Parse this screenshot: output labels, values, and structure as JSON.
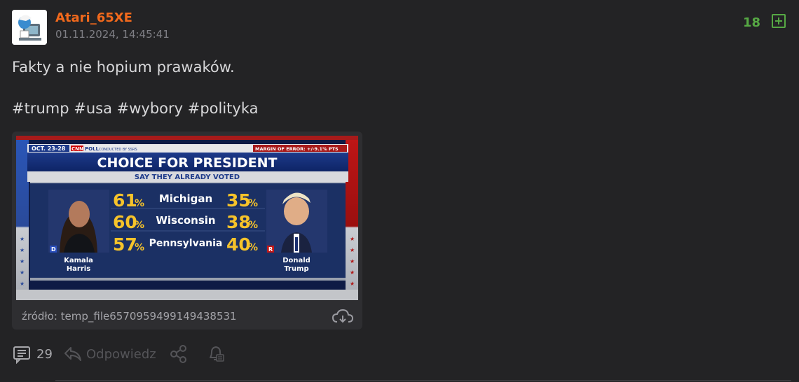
{
  "post": {
    "author": "Atari_65XE",
    "date": "01.11.2024, 14:45:41",
    "score": "18",
    "lines": [
      "Fakty a nie hopium prawaków.",
      "#trump #usa #wybory #polityka"
    ]
  },
  "image": {
    "source": "źródło: temp_file6570959499149438531",
    "graphic": {
      "date_tag": "OCT. 23-28",
      "poll_brand": "CNN",
      "poll_label": "POLL",
      "poll_sub": "CONDUCTED BY SSRS",
      "margin": "MARGIN OF ERROR: +/-9.1% PTS",
      "title": "CHOICE FOR PRESIDENT",
      "subtitle": "SAY THEY ALREADY VOTED",
      "rows": [
        {
          "state": "Michigan",
          "harris": "61",
          "trump": "35"
        },
        {
          "state": "Wisconsin",
          "harris": "60",
          "trump": "38"
        },
        {
          "state": "Pennsylvania",
          "harris": "57",
          "trump": "40"
        }
      ],
      "percent_sign": "%",
      "left": {
        "first": "Kamala",
        "last": "Harris",
        "party": "D"
      },
      "right": {
        "first": "Donald",
        "last": "Trump",
        "party": "R"
      }
    }
  },
  "actions": {
    "comments": "29",
    "reply": "Odpowiedz"
  }
}
